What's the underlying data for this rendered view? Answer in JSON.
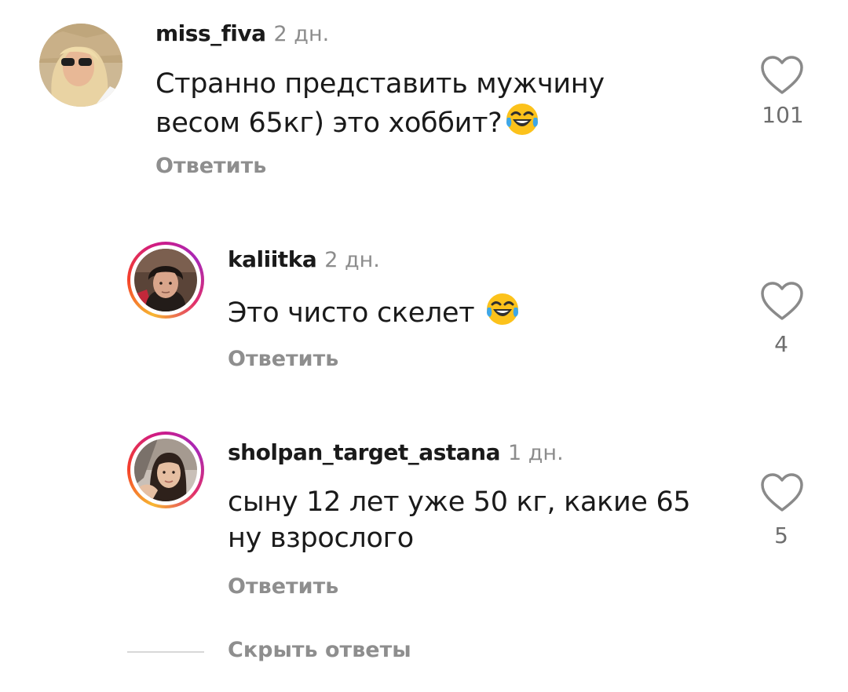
{
  "comments": [
    {
      "username": "miss_fiva",
      "time": "2 дн.",
      "text_line1": "Странно представить мужчину",
      "text_line2": "весом 65кг) это хоббит?",
      "emoji": "face-with-tears-of-joy",
      "reply_label": "Ответить",
      "likes": "101"
    },
    {
      "username": "kaliitka",
      "time": "2 дн.",
      "text_line1": "Это чисто скелет",
      "emoji": "face-with-tears-of-joy",
      "reply_label": "Ответить",
      "likes": "4"
    },
    {
      "username": "sholpan_target_astana",
      "time": "1 дн.",
      "text_line1": "сыну 12 лет уже 50 кг, какие 65",
      "text_line2": "ну взрослого",
      "reply_label": "Ответить",
      "likes": "5"
    }
  ],
  "hide_replies_label": "Скрыть ответы",
  "colors": {
    "text": "#1a1a1a",
    "muted": "#8e8e8e",
    "story_ring": [
      "#f7b731",
      "#f5402a",
      "#d01b84",
      "#a828b6"
    ]
  },
  "icons": {
    "like": "heart-outline-icon"
  }
}
